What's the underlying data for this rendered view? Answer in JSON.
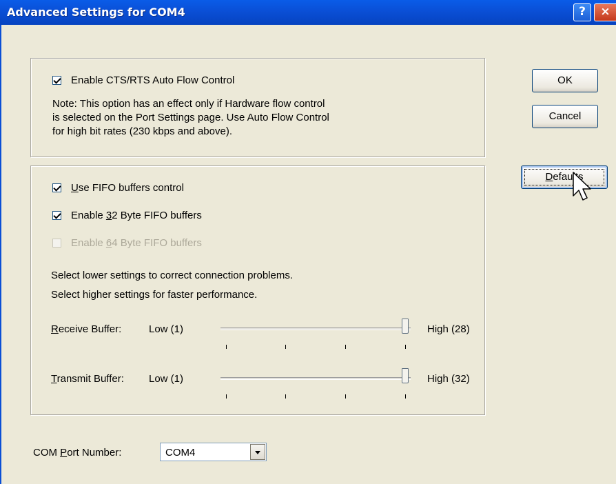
{
  "window": {
    "title": "Advanced Settings for COM4",
    "help_glyph": "?",
    "close_glyph": "×"
  },
  "flow_control": {
    "checkbox_label": "Enable CTS/RTS Auto Flow Control",
    "checked": true,
    "note_line1": "Note: This option has an effect only if Hardware flow control",
    "note_line2": "is selected on the Port Settings page. Use Auto Flow Control",
    "note_line3": "for high bit rates (230 kbps and above)."
  },
  "fifo": {
    "use_fifo": {
      "label_mnemonic": "U",
      "label_rest": "se FIFO buffers control",
      "checked": true
    },
    "enable_32": {
      "label_pre": "Enable ",
      "label_mnemonic": "3",
      "label_rest": "2 Byte FIFO buffers",
      "checked": true
    },
    "enable_64": {
      "label_pre": "Enable ",
      "label_mnemonic": "6",
      "label_rest": "4 Byte FIFO buffers",
      "checked": false,
      "disabled": true
    },
    "hint_line1": "Select lower settings to correct connection problems.",
    "hint_line2": "Select higher settings for faster performance.",
    "receive": {
      "label_mnemonic": "R",
      "label_rest": "eceive Buffer:",
      "low": "Low (1)",
      "high": "High (28)",
      "value_fraction": 1.0
    },
    "transmit": {
      "label_mnemonic": "T",
      "label_rest": "ransmit Buffer:",
      "low": "Low (1)",
      "high": "High (32)",
      "value_fraction": 1.0
    }
  },
  "buttons": {
    "ok": "OK",
    "cancel": "Cancel",
    "defaults_mnemonic": "D",
    "defaults_rest": "efaults"
  },
  "com_port": {
    "label_pre": "COM ",
    "label_mnemonic": "P",
    "label_rest": "ort Number:",
    "selected": "COM4"
  },
  "colors": {
    "title_bar": "#0a4fd6",
    "dialog_bg": "#ece9d8",
    "check_mark": "#21a121"
  },
  "icons": {
    "cursor": "arrow-cursor-icon",
    "dropdown": "chevron-down-icon"
  }
}
